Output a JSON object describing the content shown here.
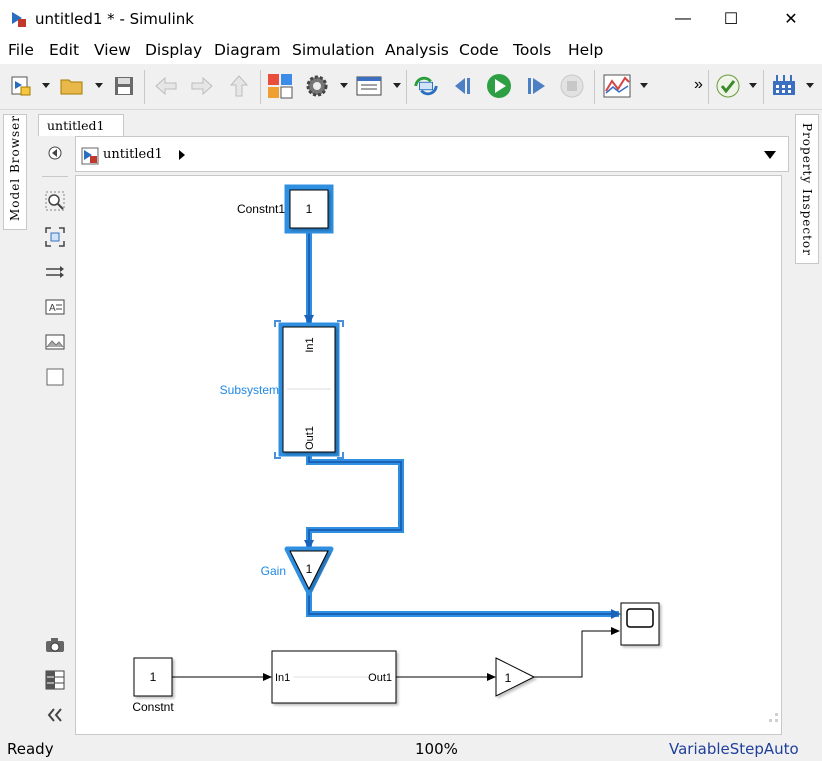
{
  "window": {
    "title": "untitled1 * - Simulink",
    "minimize": "—",
    "maximize": "☐",
    "close": "✕"
  },
  "menu": [
    "File",
    "Edit",
    "View",
    "Display",
    "Diagram",
    "Simulation",
    "Analysis",
    "Code",
    "Tools",
    "Help"
  ],
  "toolbar": {
    "overflow": "»"
  },
  "side_tabs": {
    "left": "Model Browser",
    "right": "Property Inspector"
  },
  "document_tab": "untitled1",
  "address": {
    "path": "untitled1"
  },
  "diagram": {
    "constant1": {
      "name": "Constnt1",
      "value": "1"
    },
    "subsystem": {
      "name": "Subsystem",
      "in_port": "In1",
      "out_port": "Out1"
    },
    "gain_top": {
      "name": "Gain",
      "value": "1"
    },
    "constant2": {
      "name": "Constnt",
      "value": "1"
    },
    "subsystem2": {
      "in_port": "In1",
      "out_port": "Out1"
    },
    "gain_bottom": {
      "value": "1"
    },
    "colors": {
      "highlight": "#2f8fe0",
      "highlight_dark": "#1c62b9",
      "label_blue": "#1e88e5"
    }
  },
  "status": {
    "left": "Ready",
    "zoom": "100%",
    "solver": "VariableStepAuto"
  }
}
